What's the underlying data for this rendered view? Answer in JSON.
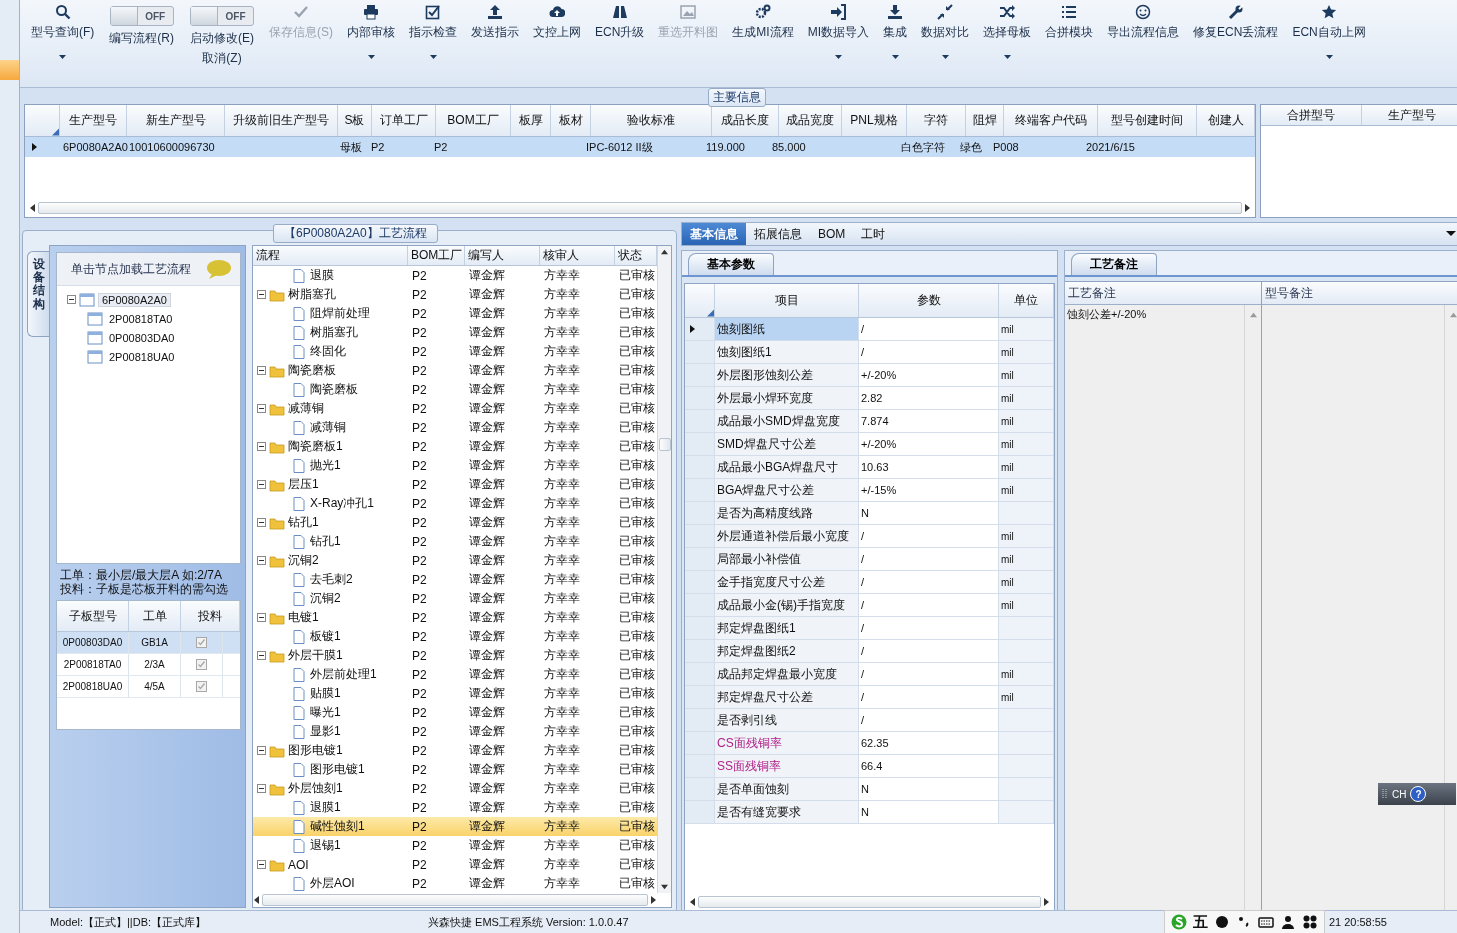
{
  "toolbar": [
    {
      "kind": "button",
      "label": "型号查询(F)",
      "menu": true,
      "disabled": false
    },
    {
      "kind": "toggle",
      "switch": "OFF",
      "on": false,
      "captions": [
        "编写流程(R)"
      ]
    },
    {
      "kind": "toggle",
      "switch": "OFF",
      "on": false,
      "captions": [
        "启动修改(E)",
        "取消(Z)"
      ]
    },
    {
      "kind": "button",
      "label": "保存信息(S)",
      "menu": false,
      "disabled": true
    },
    {
      "kind": "button",
      "label": "内部审核",
      "menu": true,
      "disabled": false
    },
    {
      "kind": "button",
      "label": "指示检查",
      "menu": true,
      "disabled": false
    },
    {
      "kind": "button",
      "label": "发送指示",
      "menu": false,
      "disabled": false
    },
    {
      "kind": "button",
      "label": "文控上网",
      "menu": false,
      "disabled": false
    },
    {
      "kind": "button",
      "label": "ECN升级",
      "menu": false,
      "disabled": false
    },
    {
      "kind": "button",
      "label": "重选开料图",
      "menu": false,
      "disabled": true
    },
    {
      "kind": "button",
      "label": "生成MI流程",
      "menu": false,
      "disabled": false
    },
    {
      "kind": "button",
      "label": "MI数据导入",
      "menu": true,
      "disabled": false
    },
    {
      "kind": "button",
      "label": "集成",
      "menu": true,
      "disabled": false
    },
    {
      "kind": "button",
      "label": "数据对比",
      "menu": true,
      "disabled": false
    },
    {
      "kind": "button",
      "label": "选择母板",
      "menu": true,
      "disabled": false
    },
    {
      "kind": "button",
      "label": "合拼模块",
      "menu": false,
      "disabled": false
    },
    {
      "kind": "button",
      "label": "导出流程信息",
      "menu": false,
      "disabled": false
    },
    {
      "kind": "button",
      "label": "修复ECN丢流程",
      "menu": false,
      "disabled": false
    },
    {
      "kind": "button",
      "label": "ECN自动上网",
      "menu": true,
      "disabled": false
    }
  ],
  "main_info": {
    "title": "主要信息",
    "columns": [
      "生产型号",
      "新生产型号",
      "升级前旧生产型号",
      "S板",
      "订单工厂",
      "BOM工厂",
      "板厚",
      "板材",
      "验收标准",
      "成品长度",
      "成品宽度",
      "PNL规格",
      "字符",
      "阻焊",
      "终端客户代码",
      "型号创建时间",
      "创建人"
    ],
    "rows": [
      {
        "selected": true,
        "cells": [
          "6P0080A2A0",
          "10010600096730",
          null,
          "母板",
          "P2",
          "P2",
          null,
          null,
          "IPC-6012 II级",
          "119.000",
          "85.000",
          null,
          "白色字符",
          "绿色",
          "P008",
          "2021/6/15",
          null
        ]
      }
    ],
    "side_columns": [
      "合拼型号",
      "生产型号"
    ]
  },
  "flow_panel": {
    "title": "【6P0080A2A0】工艺流程",
    "side_tab": "设备结构",
    "tree_hint": "单击节点加载工艺流程",
    "tree": [
      {
        "label": "6P0080A2A0",
        "expanded": true,
        "selected": true,
        "children": [
          {
            "label": "2P00818TA0",
            "selected": false
          },
          {
            "label": "0P00803DA0",
            "selected": false
          },
          {
            "label": "2P00818UA0",
            "selected": false
          }
        ]
      }
    ],
    "note_lines": [
      "工单：最小层/最大层A 如:2/7A",
      "投料：子板是芯板开料的需勾选"
    ],
    "boards": {
      "columns": [
        "子板型号",
        "工单",
        "投料"
      ],
      "rows": [
        {
          "board": "0P00803DA0",
          "order": "GB1A",
          "checked": true,
          "disabled": true,
          "selected": true
        },
        {
          "board": "2P00818TA0",
          "order": "2/3A",
          "checked": true,
          "disabled": true,
          "selected": false
        },
        {
          "board": "2P00818UA0",
          "order": "4/5A",
          "checked": true,
          "disabled": true,
          "selected": false
        }
      ]
    },
    "process": {
      "columns": [
        "流程",
        "BOM工厂",
        "编写人",
        "核审人",
        "状态"
      ],
      "rows": [
        {
          "children": [
            {
              "label": "退膜",
              "bom": "P2",
              "writer": "谭金辉",
              "reviewer": "方幸幸",
              "status": "已审核",
              "selected": false
            }
          ]
        },
        {
          "label": "树脂塞孔",
          "bom": "P2",
          "writer": "谭金辉",
          "reviewer": "方幸幸",
          "status": "已审核",
          "selected": false,
          "expanded": true,
          "children": [
            {
              "label": "阻焊前处理",
              "bom": "P2",
              "writer": "谭金辉",
              "reviewer": "方幸幸",
              "status": "已审核",
              "selected": false
            },
            {
              "label": "树脂塞孔",
              "bom": "P2",
              "writer": "谭金辉",
              "reviewer": "方幸幸",
              "status": "已审核",
              "selected": false
            },
            {
              "label": "终固化",
              "bom": "P2",
              "writer": "谭金辉",
              "reviewer": "方幸幸",
              "status": "已审核",
              "selected": false
            }
          ]
        },
        {
          "label": "陶瓷磨板",
          "bom": "P2",
          "writer": "谭金辉",
          "reviewer": "方幸幸",
          "status": "已审核",
          "selected": false,
          "expanded": true,
          "children": [
            {
              "label": "陶瓷磨板",
              "bom": "P2",
              "writer": "谭金辉",
              "reviewer": "方幸幸",
              "status": "已审核",
              "selected": false
            }
          ]
        },
        {
          "label": "减薄铜",
          "bom": "P2",
          "writer": "谭金辉",
          "reviewer": "方幸幸",
          "status": "已审核",
          "selected": false,
          "expanded": true,
          "children": [
            {
              "label": "减薄铜",
              "bom": "P2",
              "writer": "谭金辉",
              "reviewer": "方幸幸",
              "status": "已审核",
              "selected": false
            }
          ]
        },
        {
          "label": "陶瓷磨板1",
          "bom": "P2",
          "writer": "谭金辉",
          "reviewer": "方幸幸",
          "status": "已审核",
          "selected": false,
          "expanded": true,
          "children": [
            {
              "label": "抛光1",
              "bom": "P2",
              "writer": "谭金辉",
              "reviewer": "方幸幸",
              "status": "已审核",
              "selected": false
            }
          ]
        },
        {
          "label": "层压1",
          "bom": "P2",
          "writer": "谭金辉",
          "reviewer": "方幸幸",
          "status": "已审核",
          "selected": false,
          "expanded": true,
          "children": [
            {
              "label": "X-Ray冲孔1",
              "bom": "P2",
              "writer": "谭金辉",
              "reviewer": "方幸幸",
              "status": "已审核",
              "selected": false
            }
          ]
        },
        {
          "label": "钻孔1",
          "bom": "P2",
          "writer": "谭金辉",
          "reviewer": "方幸幸",
          "status": "已审核",
          "selected": false,
          "expanded": true,
          "children": [
            {
              "label": "钻孔1",
              "bom": "P2",
              "writer": "谭金辉",
              "reviewer": "方幸幸",
              "status": "已审核",
              "selected": false
            }
          ]
        },
        {
          "label": "沉铜2",
          "bom": "P2",
          "writer": "谭金辉",
          "reviewer": "方幸幸",
          "status": "已审核",
          "selected": false,
          "expanded": true,
          "children": [
            {
              "label": "去毛刺2",
              "bom": "P2",
              "writer": "谭金辉",
              "reviewer": "方幸幸",
              "status": "已审核",
              "selected": false
            },
            {
              "label": "沉铜2",
              "bom": "P2",
              "writer": "谭金辉",
              "reviewer": "方幸幸",
              "status": "已审核",
              "selected": false
            }
          ]
        },
        {
          "label": "电镀1",
          "bom": "P2",
          "writer": "谭金辉",
          "reviewer": "方幸幸",
          "status": "已审核",
          "selected": false,
          "expanded": true,
          "children": [
            {
              "label": "板镀1",
              "bom": "P2",
              "writer": "谭金辉",
              "reviewer": "方幸幸",
              "status": "已审核",
              "selected": false
            }
          ]
        },
        {
          "label": "外层干膜1",
          "bom": "P2",
          "writer": "谭金辉",
          "reviewer": "方幸幸",
          "status": "已审核",
          "selected": false,
          "expanded": true,
          "children": [
            {
              "label": "外层前处理1",
              "bom": "P2",
              "writer": "谭金辉",
              "reviewer": "方幸幸",
              "status": "已审核",
              "selected": false
            },
            {
              "label": "贴膜1",
              "bom": "P2",
              "writer": "谭金辉",
              "reviewer": "方幸幸",
              "status": "已审核",
              "selected": false
            },
            {
              "label": "曝光1",
              "bom": "P2",
              "writer": "谭金辉",
              "reviewer": "方幸幸",
              "status": "已审核",
              "selected": false
            },
            {
              "label": "显影1",
              "bom": "P2",
              "writer": "谭金辉",
              "reviewer": "方幸幸",
              "status": "已审核",
              "selected": false
            }
          ]
        },
        {
          "label": "图形电镀1",
          "bom": "P2",
          "writer": "谭金辉",
          "reviewer": "方幸幸",
          "status": "已审核",
          "selected": false,
          "expanded": true,
          "children": [
            {
              "label": "图形电镀1",
              "bom": "P2",
              "writer": "谭金辉",
              "reviewer": "方幸幸",
              "status": "已审核",
              "selected": false
            }
          ]
        },
        {
          "label": "外层蚀刻1",
          "bom": "P2",
          "writer": "谭金辉",
          "reviewer": "方幸幸",
          "status": "已审核",
          "selected": false,
          "expanded": true,
          "children": [
            {
              "label": "退膜1",
              "bom": "P2",
              "writer": "谭金辉",
              "reviewer": "方幸幸",
              "status": "已审核",
              "selected": false
            },
            {
              "label": "碱性蚀刻1",
              "bom": "P2",
              "writer": "谭金辉",
              "reviewer": "方幸幸",
              "status": "已审核",
              "selected": true
            },
            {
              "label": "退锡1",
              "bom": "P2",
              "writer": "谭金辉",
              "reviewer": "方幸幸",
              "status": "已审核",
              "selected": false
            }
          ]
        },
        {
          "label": "AOI",
          "bom": "P2",
          "writer": "谭金辉",
          "reviewer": "方幸幸",
          "status": "已审核",
          "selected": false,
          "expanded": true,
          "children": [
            {
              "label": "外层AOI",
              "bom": "P2",
              "writer": "谭金辉",
              "reviewer": "方幸幸",
              "status": "已审核",
              "selected": false
            }
          ]
        }
      ]
    }
  },
  "detail": {
    "tabs": [
      {
        "label": "基本信息",
        "selected": true
      },
      {
        "label": "拓展信息",
        "selected": false
      },
      {
        "label": "BOM",
        "selected": false
      },
      {
        "label": "工时",
        "selected": false
      }
    ],
    "params": {
      "tab": "基本参数",
      "columns": [
        "项目",
        "参数",
        "单位"
      ],
      "rows": [
        {
          "item": "蚀刻图纸",
          "value": "/",
          "unit": "mil",
          "kind": "normal",
          "selected": true
        },
        {
          "item": "蚀刻图纸1",
          "value": "/",
          "unit": "mil",
          "kind": "normal",
          "selected": false
        },
        {
          "item": "外层图形蚀刻公差",
          "value": "+/-20%",
          "unit": "mil",
          "kind": "normal",
          "selected": false
        },
        {
          "item": "外层最小焊环宽度",
          "value": "2.82",
          "unit": "mil",
          "kind": "normal",
          "selected": false
        },
        {
          "item": "成品最小SMD焊盘宽度",
          "value": "7.874",
          "unit": "mil",
          "kind": "normal",
          "selected": false
        },
        {
          "item": "SMD焊盘尺寸公差",
          "value": "+/-20%",
          "unit": "mil",
          "kind": "normal",
          "selected": false
        },
        {
          "item": "成品最小BGA焊盘尺寸",
          "value": "10.63",
          "unit": "mil",
          "kind": "normal",
          "selected": false
        },
        {
          "item": "BGA焊盘尺寸公差",
          "value": "+/-15%",
          "unit": "mil",
          "kind": "normal",
          "selected": false
        },
        {
          "item": "是否为高精度线路",
          "value": "N",
          "kind": "normal",
          "selected": false
        },
        {
          "item": "外层通道补偿后最小宽度",
          "value": "/",
          "unit": "mil",
          "kind": "normal",
          "selected": false
        },
        {
          "item": "局部最小补偿值",
          "value": "/",
          "unit": "mil",
          "kind": "normal",
          "selected": false
        },
        {
          "item": "金手指宽度尺寸公差",
          "value": "/",
          "unit": "mil",
          "kind": "normal",
          "selected": false
        },
        {
          "item": "成品最小金(锡)手指宽度",
          "value": "/",
          "unit": "mil",
          "kind": "normal",
          "selected": false
        },
        {
          "item": "邦定焊盘图纸1",
          "value": "/",
          "kind": "normal",
          "selected": false
        },
        {
          "item": "邦定焊盘图纸2",
          "value": "/",
          "kind": "normal",
          "selected": false
        },
        {
          "item": "成品邦定焊盘最小宽度",
          "value": "/",
          "unit": "mil",
          "kind": "normal",
          "selected": false
        },
        {
          "item": "邦定焊盘尺寸公差",
          "value": "/",
          "unit": "mil",
          "kind": "normal",
          "selected": false
        },
        {
          "item": "是否剥引线",
          "value": "/",
          "kind": "normal",
          "selected": false
        },
        {
          "item": "CS面残铜率",
          "value": "62.35",
          "kind": "surface",
          "selected": false
        },
        {
          "item": "SS面残铜率",
          "value": "66.4",
          "kind": "surface",
          "selected": false
        },
        {
          "item": "是否单面蚀刻",
          "value": "N",
          "kind": "normal",
          "selected": false
        },
        {
          "item": "是否有缝宽要求",
          "value": "N",
          "kind": "normal",
          "selected": false
        }
      ]
    },
    "notes": {
      "tab": "工艺备注",
      "columns": [
        "工艺备注",
        "型号备注"
      ],
      "cells": [
        "蚀刻公差+/-20%"
      ]
    }
  },
  "status_bar": {
    "left": "Model:【正式】||DB:【正式库】",
    "center": "兴森快捷 EMS工程系统 Version: 1.0.0.47",
    "clock": "21 20:58:55"
  },
  "ime": {
    "mode": "五"
  },
  "lang_bar": {
    "lang": "CH",
    "help": "?"
  }
}
